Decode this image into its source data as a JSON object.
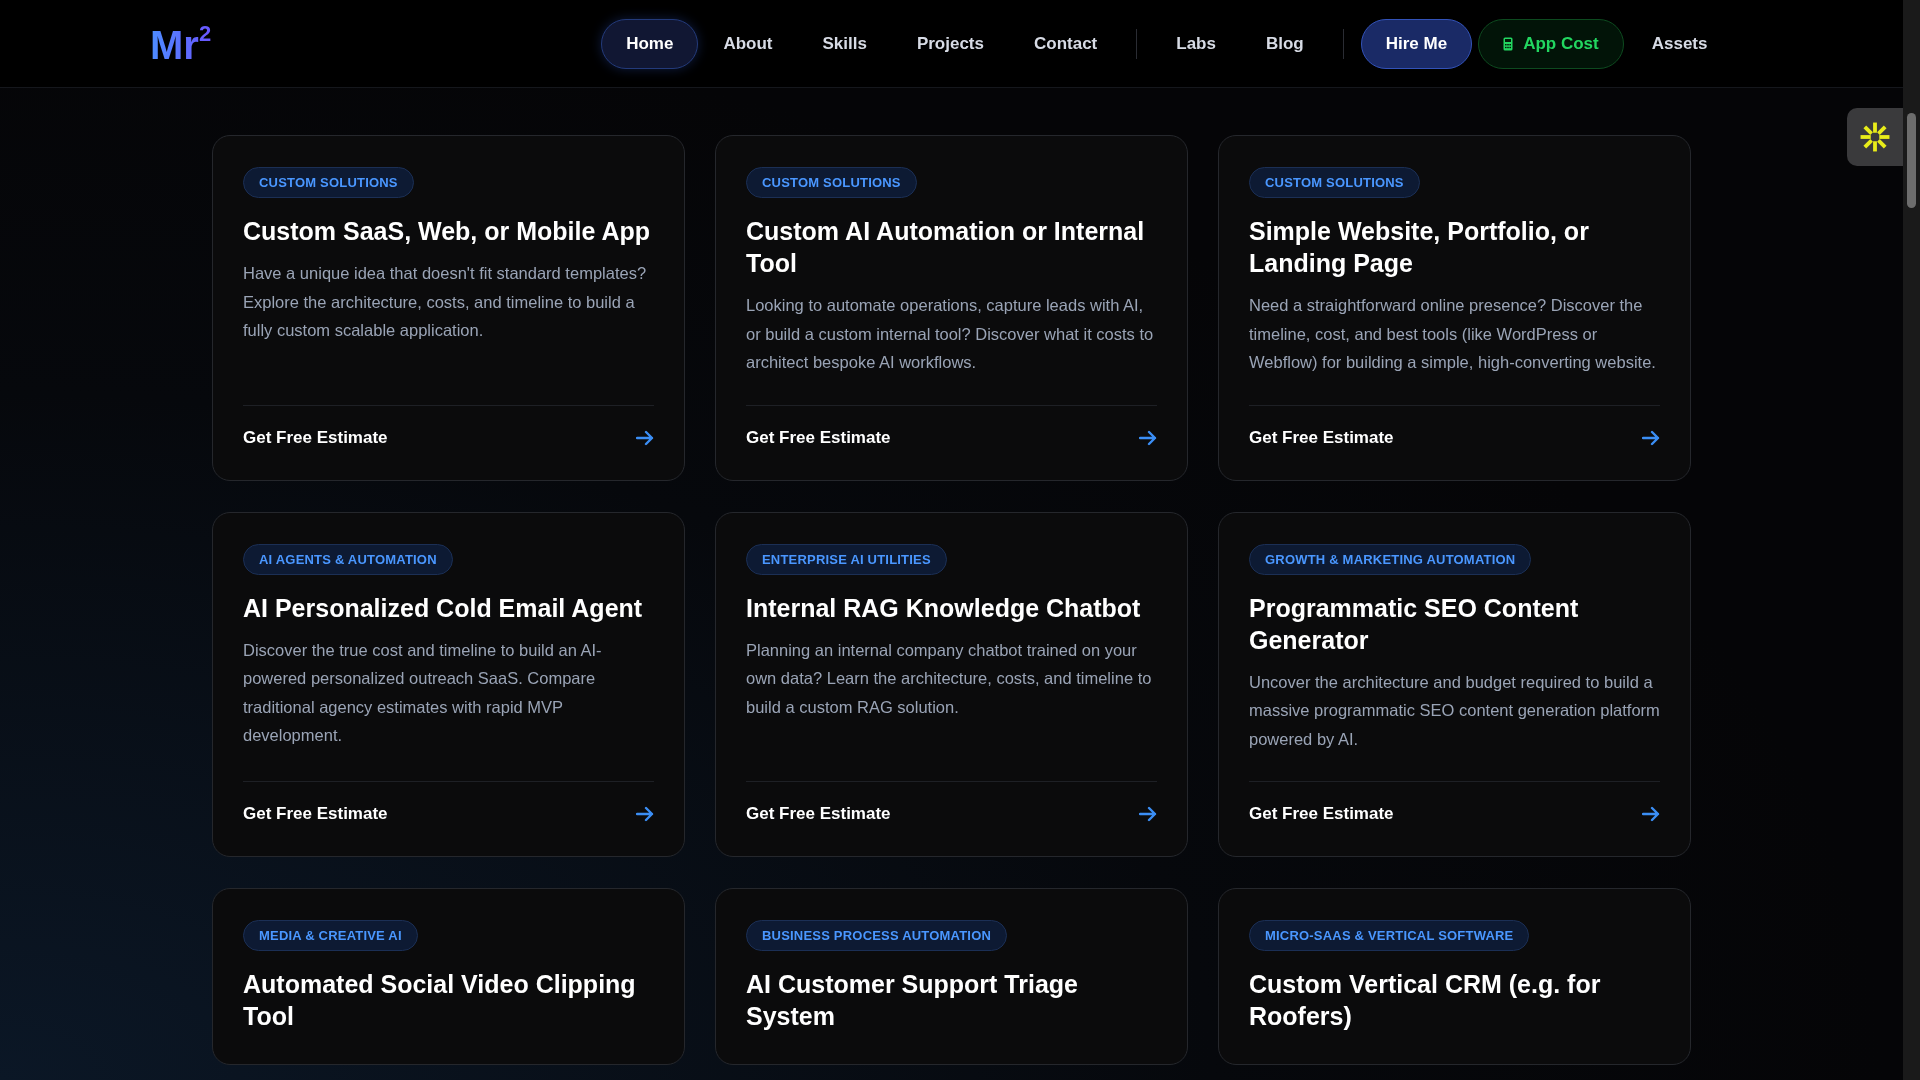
{
  "logo": {
    "text": "Mr",
    "superscript": "2"
  },
  "nav": [
    {
      "kind": "link",
      "label": "Home",
      "selected": true
    },
    {
      "kind": "link",
      "label": "About",
      "selected": false
    },
    {
      "kind": "link",
      "label": "Skills",
      "selected": false
    },
    {
      "kind": "link",
      "label": "Projects",
      "selected": false
    },
    {
      "kind": "link",
      "label": "Contact",
      "selected": false
    },
    {
      "kind": "divider"
    },
    {
      "kind": "link",
      "label": "Labs",
      "selected": false
    },
    {
      "kind": "link",
      "label": "Blog",
      "selected": false
    },
    {
      "kind": "divider"
    },
    {
      "kind": "primary",
      "label": "Hire Me"
    },
    {
      "kind": "accent",
      "label": "App Cost"
    },
    {
      "kind": "link",
      "label": "Assets",
      "selected": false
    }
  ],
  "cards": [
    {
      "tag": "CUSTOM SOLUTIONS",
      "title": "Custom SaaS, Web, or Mobile App",
      "description": "Have a unique idea that doesn't fit standard templates? Explore the architecture, costs, and timeline to build a fully custom scalable application.",
      "link": "Get Free Estimate"
    },
    {
      "tag": "CUSTOM SOLUTIONS",
      "title": "Custom AI Automation or Internal Tool",
      "description": "Looking to automate operations, capture leads with AI, or build a custom internal tool? Discover what it costs to architect bespoke AI workflows.",
      "link": "Get Free Estimate"
    },
    {
      "tag": "CUSTOM SOLUTIONS",
      "title": "Simple Website, Portfolio, or Landing Page",
      "description": "Need a straightforward online presence? Discover the timeline, cost, and best tools (like WordPress or Webflow) for building a simple, high-converting website.",
      "link": "Get Free Estimate"
    },
    {
      "tag": "AI AGENTS & AUTOMATION",
      "title": "AI Personalized Cold Email Agent",
      "description": "Discover the true cost and timeline to build an AI-powered personalized outreach SaaS. Compare traditional agency estimates with rapid MVP development.",
      "link": "Get Free Estimate"
    },
    {
      "tag": "ENTERPRISE AI UTILITIES",
      "title": "Internal RAG Knowledge Chatbot",
      "description": "Planning an internal company chatbot trained on your own data? Learn the architecture, costs, and timeline to build a custom RAG solution.",
      "link": "Get Free Estimate"
    },
    {
      "tag": "GROWTH & MARKETING AUTOMATION",
      "title": "Programmatic SEO Content Generator",
      "description": "Uncover the architecture and budget required to build a massive programmatic SEO content generation platform powered by AI.",
      "link": "Get Free Estimate"
    },
    {
      "tag": "MEDIA & CREATIVE AI",
      "title": "Automated Social Video Clipping Tool"
    },
    {
      "tag": "BUSINESS PROCESS AUTOMATION",
      "title": "AI Customer Support Triage System"
    },
    {
      "tag": "MICRO-SAAS & VERTICAL SOFTWARE",
      "title": "Custom Vertical CRM (e.g. for Roofers)"
    }
  ]
}
